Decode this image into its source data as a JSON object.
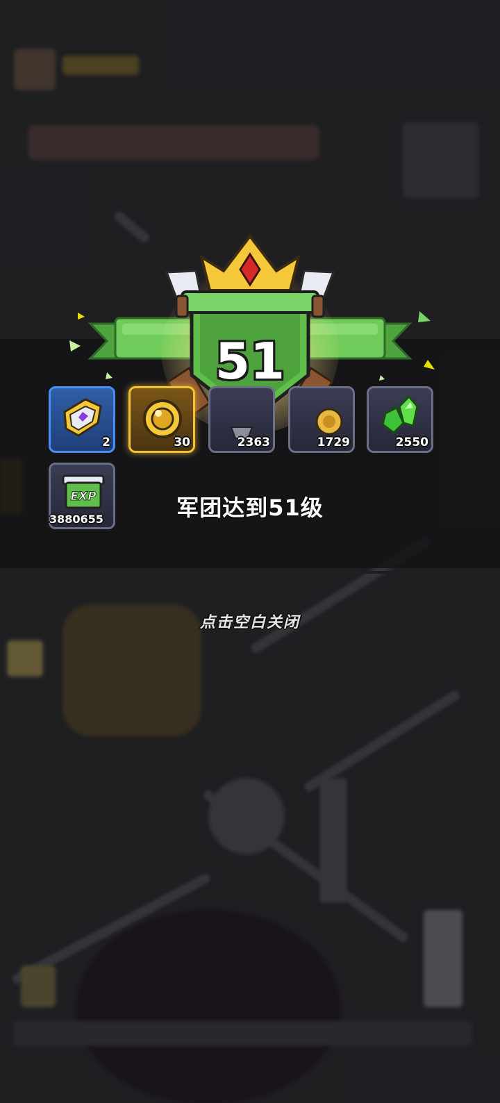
{
  "popup": {
    "level": "51",
    "message": "军团达到51级",
    "close_hint": "点击空白关闭"
  },
  "rewards": [
    {
      "icon": "gold-shield-emblem-icon",
      "count": "2",
      "frame": "blue"
    },
    {
      "icon": "gold-coin-icon",
      "count": "30",
      "frame": "gold"
    },
    {
      "icon": "silver-item-icon",
      "count": "2363",
      "frame": "gray"
    },
    {
      "icon": "gold-medal-icon",
      "count": "1729",
      "frame": "gray"
    },
    {
      "icon": "green-crystal-icon",
      "count": "2550",
      "frame": "gray"
    },
    {
      "icon": "exp-scroll-icon",
      "count": "3880655",
      "frame": "gray",
      "label": "EXP"
    }
  ],
  "colors": {
    "banner_green": "#5fbf4a",
    "crown_gold": "#f5c83a",
    "gem_red": "#d62a2a",
    "panel": "#141416"
  }
}
